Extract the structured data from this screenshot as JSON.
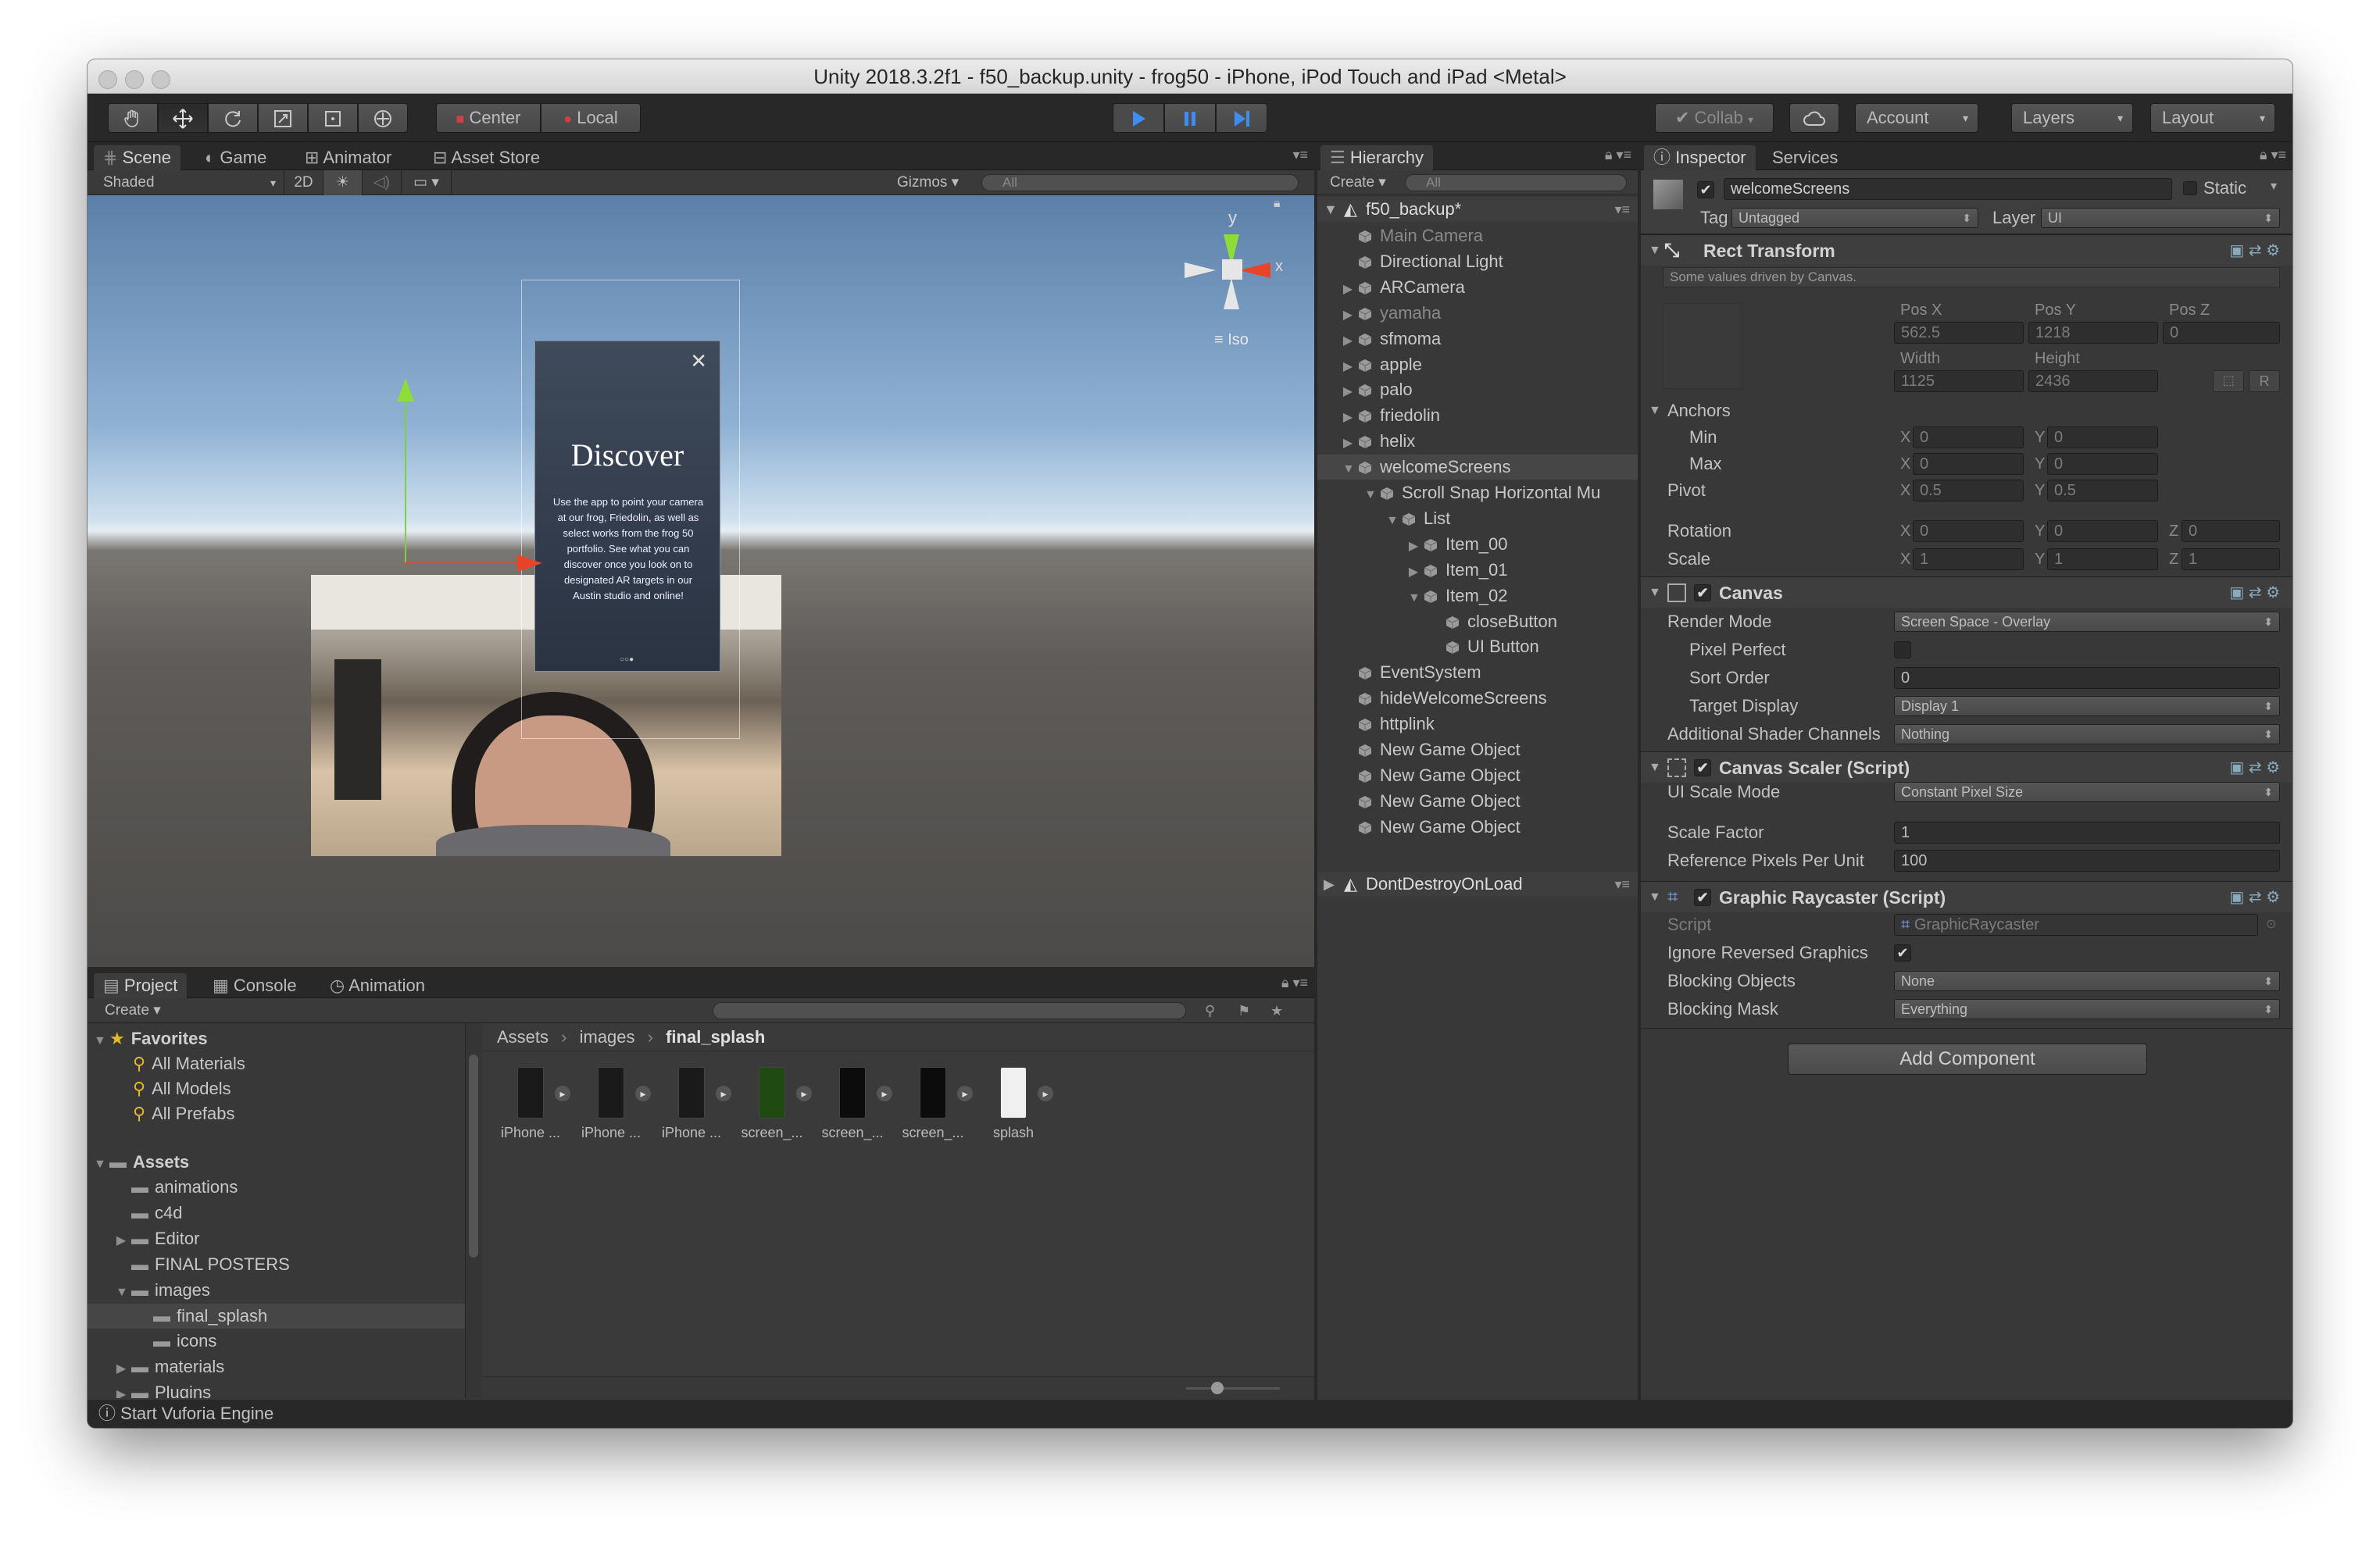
{
  "window": {
    "title": "Unity 2018.3.2f1 - f50_backup.unity - frog50 - iPhone, iPod Touch and iPad <Metal>"
  },
  "toolbar": {
    "center_label": "Center",
    "local_label": "Local",
    "collab_label": "Collab",
    "account_label": "Account",
    "layers_label": "Layers",
    "layout_label": "Layout"
  },
  "scene_panel": {
    "tabs": [
      "Scene",
      "Game",
      "Animator",
      "Asset Store"
    ],
    "shading_mode": "Shaded",
    "mode_2d": "2D",
    "gizmos_label": "Gizmos",
    "search_placeholder": "All",
    "gizmo_labels": {
      "y": "y",
      "x": "x",
      "iso": "Iso"
    },
    "ui_card": {
      "heading": "Discover",
      "body": "Use the app to point your camera at our frog, Friedolin, as well as select works from the frog 50 portfolio. See what you can discover once you look on to designated AR targets in our Austin studio and online!"
    }
  },
  "hierarchy": {
    "tab": "Hierarchy",
    "create_label": "Create",
    "search_placeholder": "All",
    "scene_name": "f50_backup*",
    "items": [
      {
        "label": "Main Camera"
      },
      {
        "label": "Directional Light"
      },
      {
        "label": "ARCamera"
      },
      {
        "label": "yamaha"
      },
      {
        "label": "sfmoma"
      },
      {
        "label": "apple"
      },
      {
        "label": "palo"
      },
      {
        "label": "friedolin"
      },
      {
        "label": "helix"
      },
      {
        "label": "welcomeScreens"
      },
      {
        "label": "Scroll Snap Horizontal Mu"
      },
      {
        "label": "List"
      },
      {
        "label": "Item_00"
      },
      {
        "label": "Item_01"
      },
      {
        "label": "Item_02"
      },
      {
        "label": "closeButton"
      },
      {
        "label": "UI Button"
      },
      {
        "label": "EventSystem"
      },
      {
        "label": "hideWelcomeScreens"
      },
      {
        "label": "httplink"
      },
      {
        "label": "New Game Object"
      },
      {
        "label": "New Game Object"
      },
      {
        "label": "New Game Object"
      },
      {
        "label": "New Game Object"
      }
    ],
    "dont_destroy": "DontDestroyOnLoad"
  },
  "inspector": {
    "tabs": [
      "Inspector",
      "Services"
    ],
    "object_name": "welcomeScreens",
    "static_label": "Static",
    "tag_label": "Tag",
    "tag_value": "Untagged",
    "layer_label": "Layer",
    "layer_value": "UI",
    "rect_transform": {
      "title": "Rect Transform",
      "note": "Some values driven by Canvas.",
      "pos_x_label": "Pos X",
      "pos_y_label": "Pos Y",
      "pos_z_label": "Pos Z",
      "pos_x": "562.5",
      "pos_y": "1218",
      "pos_z": "0",
      "width_label": "Width",
      "height_label": "Height",
      "width": "1125",
      "height": "2436",
      "r_label": "R",
      "anchors_label": "Anchors",
      "min_label": "Min",
      "max_label": "Max",
      "min_x": "0",
      "min_y": "0",
      "max_x": "0",
      "max_y": "0",
      "pivot_label": "Pivot",
      "pivot_x": "0.5",
      "pivot_y": "0.5",
      "rotation_label": "Rotation",
      "rot_x": "0",
      "rot_y": "0",
      "rot_z": "0",
      "scale_label": "Scale",
      "scale_x": "1",
      "scale_y": "1",
      "scale_z": "1",
      "axis_x": "X",
      "axis_y": "Y",
      "axis_z": "Z"
    },
    "canvas": {
      "title": "Canvas",
      "render_mode_label": "Render Mode",
      "render_mode": "Screen Space - Overlay",
      "pixel_perfect_label": "Pixel Perfect",
      "sort_order_label": "Sort Order",
      "sort_order": "0",
      "target_display_label": "Target Display",
      "target_display": "Display 1",
      "shader_channels_label": "Additional Shader Channels",
      "shader_channels": "Nothing"
    },
    "canvas_scaler": {
      "title": "Canvas Scaler (Script)",
      "scale_mode_label": "UI Scale Mode",
      "scale_mode": "Constant Pixel Size",
      "scale_factor_label": "Scale Factor",
      "scale_factor": "1",
      "ref_ppu_label": "Reference Pixels Per Unit",
      "ref_ppu": "100"
    },
    "graphic_raycaster": {
      "title": "Graphic Raycaster (Script)",
      "script_label": "Script",
      "script_value": "GraphicRaycaster",
      "ignore_reversed_label": "Ignore Reversed Graphics",
      "blocking_objects_label": "Blocking Objects",
      "blocking_objects": "None",
      "blocking_mask_label": "Blocking Mask",
      "blocking_mask": "Everything"
    },
    "add_component": "Add Component"
  },
  "project": {
    "tabs": [
      "Project",
      "Console",
      "Animation"
    ],
    "create_label": "Create",
    "favorites_label": "Favorites",
    "favorites": [
      "All Materials",
      "All Models",
      "All Prefabs"
    ],
    "assets_label": "Assets",
    "folders": [
      "animations",
      "c4d",
      "Editor",
      "FINAL POSTERS",
      "images",
      "final_splash",
      "icons",
      "materials",
      "Plugins"
    ],
    "breadcrumb": [
      "Assets",
      "images",
      "final_splash"
    ],
    "files": [
      "iPhone ...",
      "iPhone ...",
      "iPhone ...",
      "screen_...",
      "screen_...",
      "screen_...",
      "splash"
    ]
  },
  "status_bar": {
    "message": "Start Vuforia Engine"
  },
  "colors": {
    "play_accent": "#3d8ef0",
    "selection": "#464646",
    "panel_bg": "#383838",
    "window_bg": "#282828"
  }
}
